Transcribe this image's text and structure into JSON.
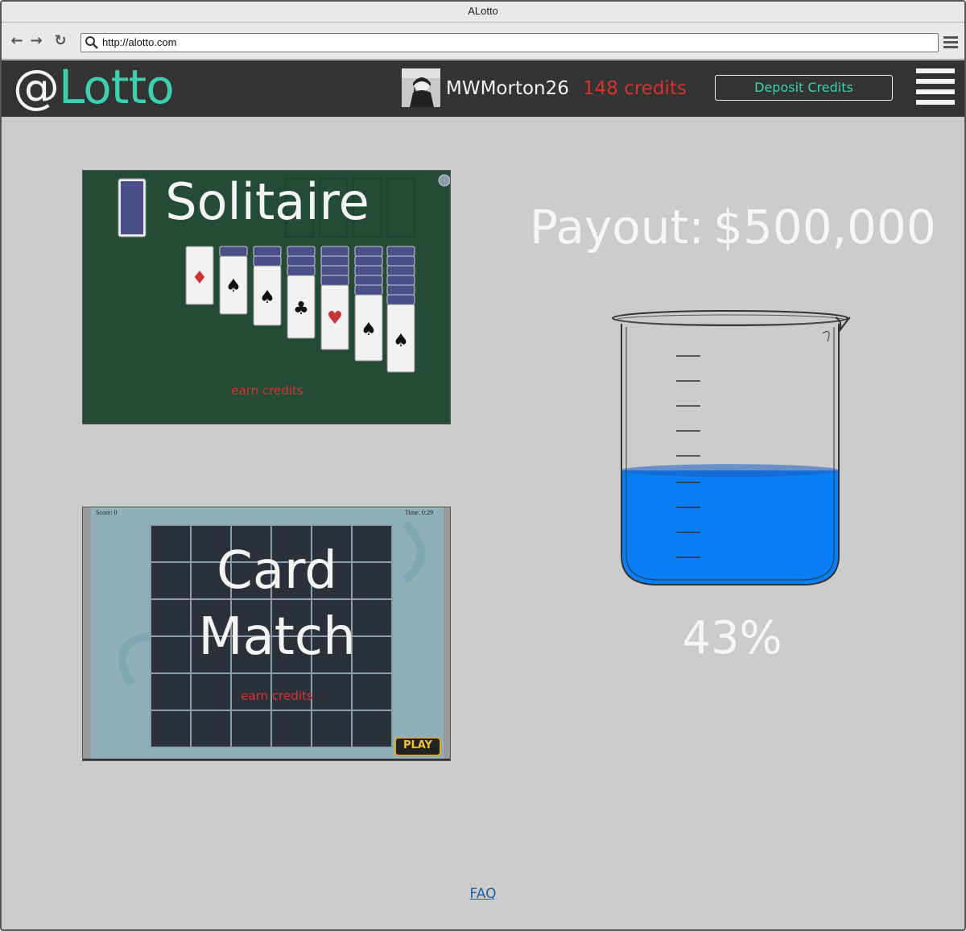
{
  "window": {
    "title": "ALotto"
  },
  "browser": {
    "url": "http://alotto.com"
  },
  "header": {
    "logo_symbol": "@",
    "logo_name": "Lotto",
    "username": "MWMorton26",
    "credits": "148 credits",
    "deposit_label": "Deposit Credits"
  },
  "games": [
    {
      "title": "Solitaire",
      "earn_label": "earn credits"
    },
    {
      "title_line1": "Card",
      "title_line2": "Match",
      "earn_label": "earn credits",
      "score_text": "Score: 0",
      "time_text": "Time: 0:29",
      "badge": "PLAY"
    }
  ],
  "payout": {
    "label": "Payout:",
    "value": "$500,000"
  },
  "progress": {
    "percent_text": "43%",
    "fill_fraction": 0.43
  },
  "footer": {
    "faq_label": "FAQ"
  },
  "colors": {
    "accent": "#3ecfb0",
    "credits": "#d2332b",
    "header_bg": "#333333",
    "page_bg": "#cccccc",
    "water": "#0a7ff5"
  }
}
